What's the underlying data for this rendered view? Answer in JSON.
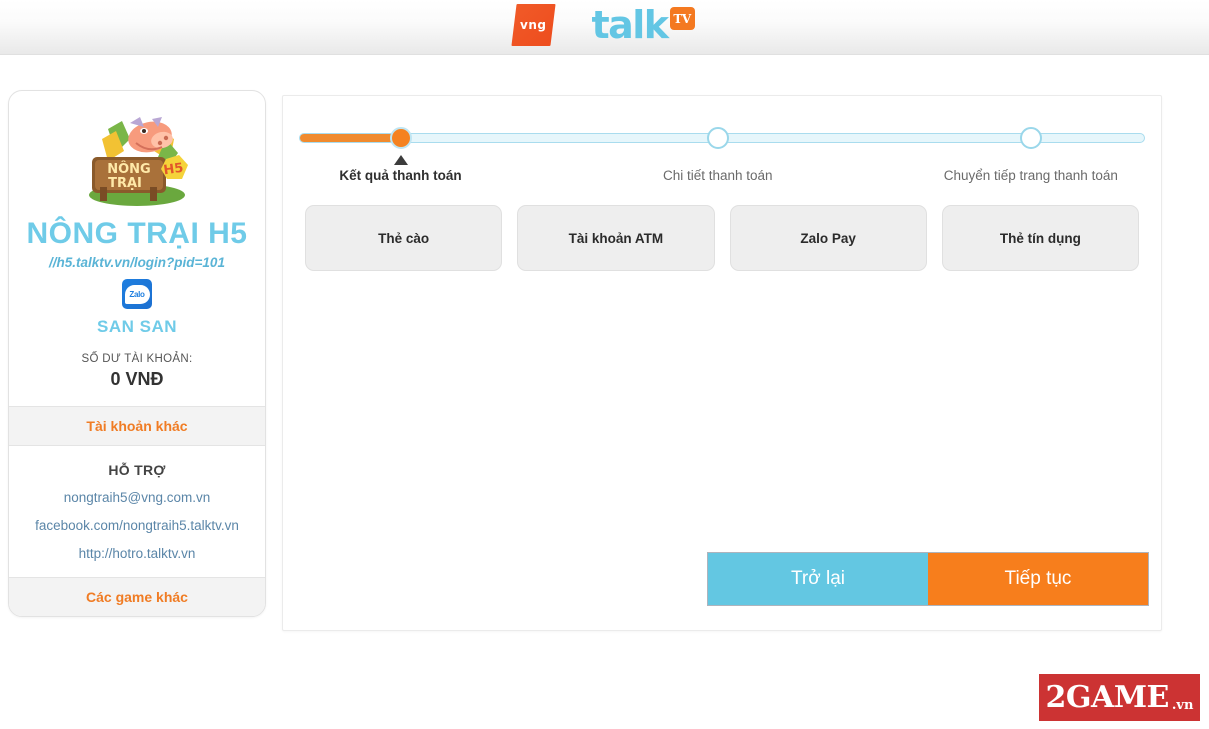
{
  "header": {
    "vng_logo_text": "vng",
    "talk_word": "talk",
    "tv_badge": "TV"
  },
  "sidebar": {
    "game_title": "NÔNG TRẠI H5",
    "game_url": "//h5.talktv.vn/login?pid=101",
    "zalo_label": "Zalo",
    "account_name": "SAN SAN",
    "balance_label": "SỐ DƯ TÀI KHOẢN:",
    "balance_value": "0 VNĐ",
    "other_account": "Tài khoản khác",
    "support_title": "HỖ TRỢ",
    "support_links": [
      "nongtraih5@vng.com.vn",
      "facebook.com/nongtraih5.talktv.vn",
      "http://hotro.talktv.vn"
    ],
    "other_games": "Các game khác"
  },
  "stepper": {
    "steps": [
      {
        "label": "Kết quả thanh toán",
        "active": true,
        "pos": 12
      },
      {
        "label": "Chi tiết thanh toán",
        "active": false,
        "pos": 49.5
      },
      {
        "label": "Chuyển tiếp trang thanh toán",
        "active": false,
        "pos": 86.5
      }
    ]
  },
  "payment_methods": [
    {
      "label": "Thẻ cào"
    },
    {
      "label": "Tài khoản ATM"
    },
    {
      "label": "Zalo Pay"
    },
    {
      "label": "Thẻ tín dụng"
    }
  ],
  "actions": {
    "back": "Trở lại",
    "next": "Tiếp tục"
  },
  "watermark": {
    "main": "2GAME",
    "suffix": ".vn"
  },
  "colors": {
    "accent_orange": "#f47920",
    "accent_blue": "#63c7e2",
    "title_blue": "#6fcbe8",
    "watermark_red": "#cc3333",
    "panel_bg": "#ffffff",
    "tab_bg": "#eeeeee"
  }
}
